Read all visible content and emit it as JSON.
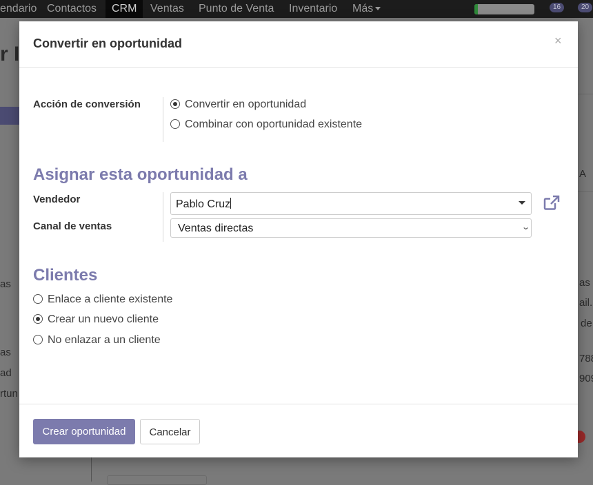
{
  "topbar": {
    "menu": [
      "endario",
      "Contactos",
      "CRM",
      "Ventas",
      "Punto de Venta",
      "Inventario",
      "Más"
    ],
    "activity_progress": 0.06,
    "badges": [
      "16",
      "20"
    ]
  },
  "background": {
    "left_texts": [
      "r I",
      "as",
      "as",
      "ad",
      "rtun"
    ],
    "right_texts": [
      "A",
      "as S",
      "ail.",
      "de",
      "788",
      "909"
    ]
  },
  "modal": {
    "title": "Convertir en oportunidad",
    "close_symbol": "×",
    "conversion": {
      "label": "Acción de conversión",
      "options": [
        "Convertir en oportunidad",
        "Combinar con oportunidad existente"
      ],
      "selected": 0
    },
    "assign": {
      "title": "Asignar esta oportunidad a",
      "salesperson_label": "Vendedor",
      "salesperson_value": "Pablo Cruz",
      "team_label": "Canal de ventas",
      "team_value": "Ventas directas"
    },
    "customers": {
      "title": "Clientes",
      "options": [
        "Enlace a cliente existente",
        "Crear un nuevo cliente",
        "No enlazar a un cliente"
      ],
      "selected": 1
    },
    "footer": {
      "primary_label": "Crear oportunidad",
      "secondary_label": "Cancelar"
    }
  },
  "colors": {
    "accent": "#7c7bad",
    "topbar": "#1c1c1c",
    "overlay": "#7a7a7a"
  }
}
